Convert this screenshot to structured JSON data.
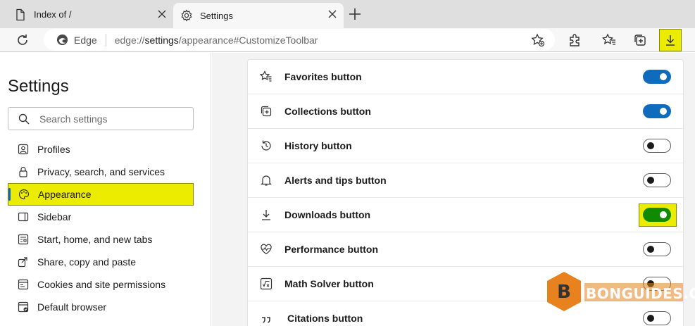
{
  "tabs": [
    {
      "label": "Index of /",
      "active": false
    },
    {
      "label": "Settings",
      "active": true
    }
  ],
  "toolbar": {
    "brand": "Edge",
    "url_prefix": "edge://",
    "url_strong": "settings",
    "url_rest": "/appearance#CustomizeToolbar"
  },
  "sidebar": {
    "title": "Settings",
    "search_placeholder": "Search settings",
    "items": [
      {
        "label": "Profiles",
        "icon": "profile-icon"
      },
      {
        "label": "Privacy, search, and services",
        "icon": "lock-icon"
      },
      {
        "label": "Appearance",
        "icon": "palette-icon",
        "active": true
      },
      {
        "label": "Sidebar",
        "icon": "sidebar-icon"
      },
      {
        "label": "Start, home, and new tabs",
        "icon": "home-tabs-icon"
      },
      {
        "label": "Share, copy and paste",
        "icon": "share-icon"
      },
      {
        "label": "Cookies and site permissions",
        "icon": "cookies-icon"
      },
      {
        "label": "Default browser",
        "icon": "default-browser-icon"
      }
    ]
  },
  "toolbar_buttons": [
    {
      "label": "Favorites button",
      "icon": "favorites-icon",
      "on": true
    },
    {
      "label": "Collections button",
      "icon": "collections-icon",
      "on": true
    },
    {
      "label": "History button",
      "icon": "history-icon",
      "on": false
    },
    {
      "label": "Alerts and tips button",
      "icon": "bell-icon",
      "on": false
    },
    {
      "label": "Downloads button",
      "icon": "download-icon",
      "on": true
    },
    {
      "label": "Performance button",
      "icon": "heartbeat-icon",
      "on": false
    },
    {
      "label": "Math Solver button",
      "icon": "math-solver-icon",
      "on": false
    },
    {
      "label": "Citations button",
      "icon": "quote-icon",
      "on": false
    }
  ],
  "watermark": "BONGUIDES.COM",
  "colors": {
    "accent": "#0f6cbd",
    "highlight": "#ecec00",
    "downloads_toggle": "#108a00",
    "watermark": "#e8821e"
  }
}
